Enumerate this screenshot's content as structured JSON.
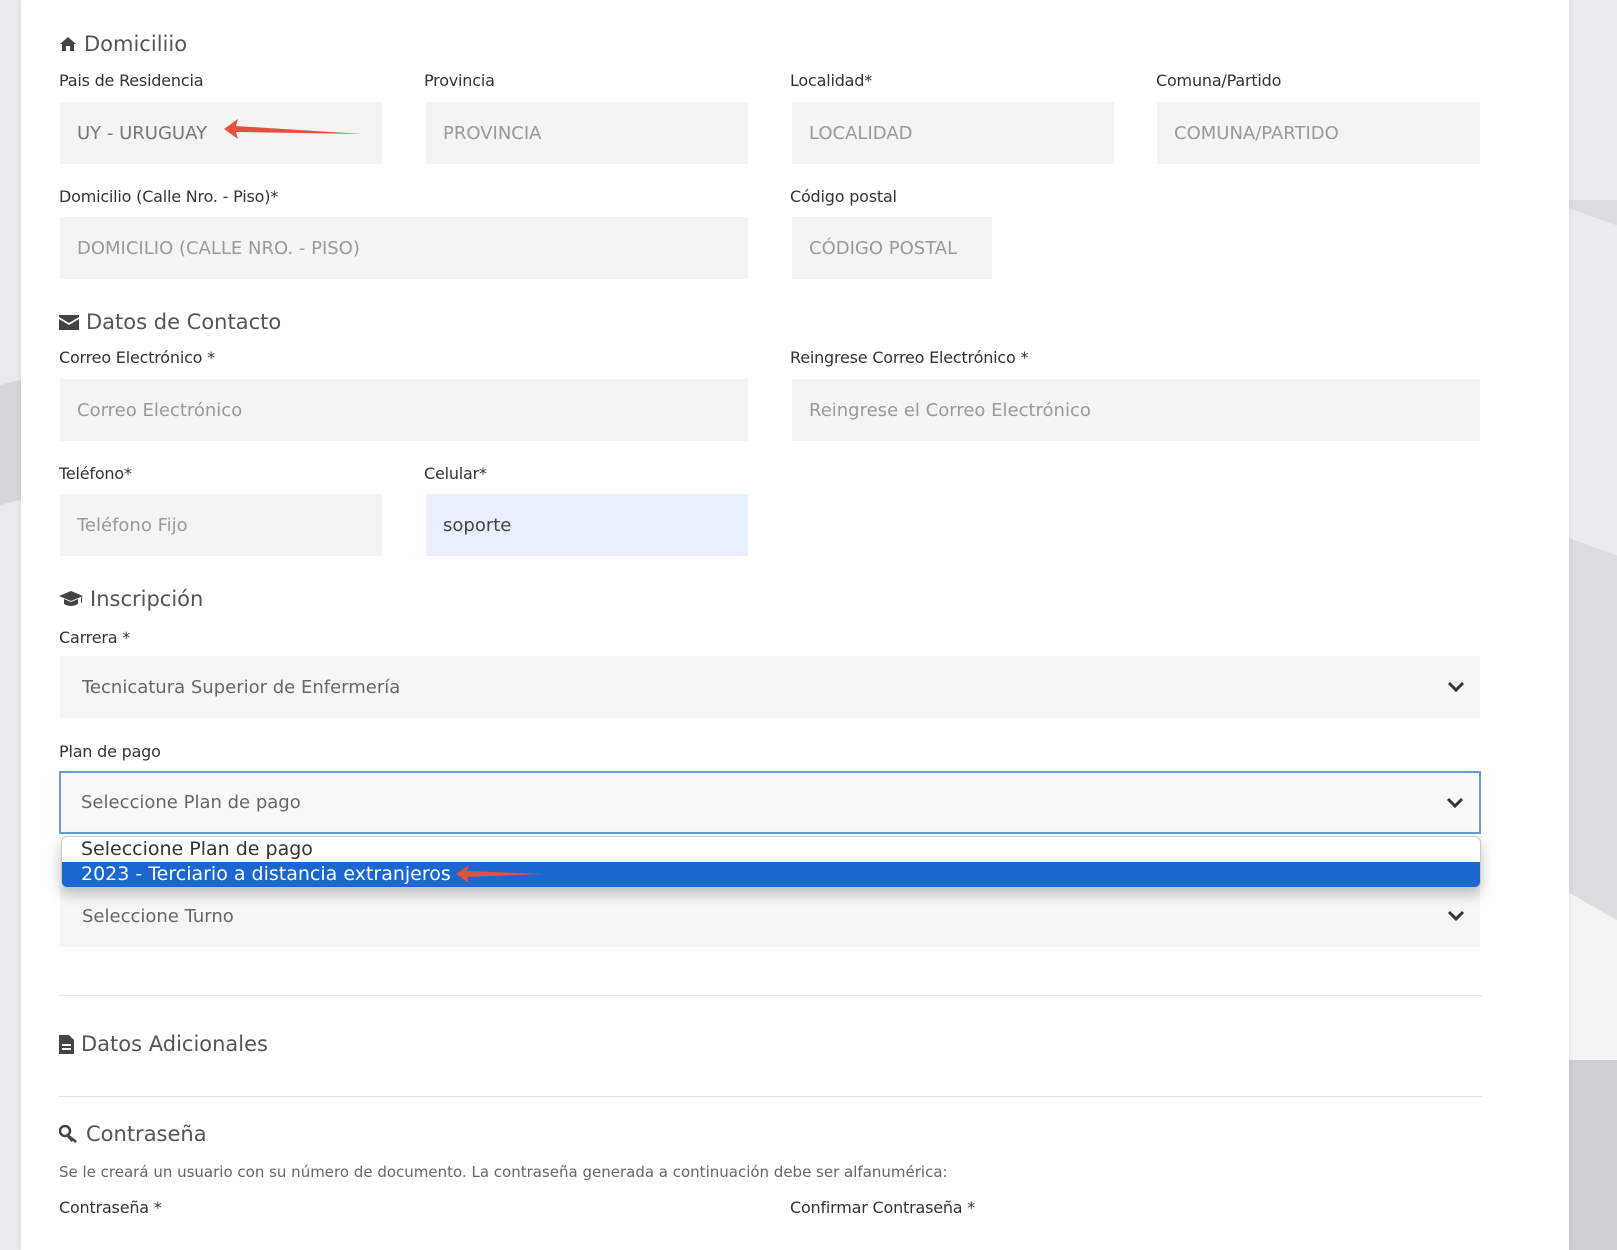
{
  "domicilio": {
    "title": "Domiciliio",
    "labels": {
      "pais": "Pais de Residencia",
      "provincia": "Provincia",
      "localidad": "Localidad*",
      "comuna": "Comuna/Partido",
      "domicilio": "Domicilio (Calle Nro. - Piso)*",
      "codigo_postal": "Código postal"
    },
    "values": {
      "pais": "UY - URUGUAY"
    },
    "placeholders": {
      "provincia": "PROVINCIA",
      "localidad": "LOCALIDAD",
      "comuna": "COMUNA/PARTIDO",
      "domicilio": "DOMICILIO (CALLE NRO. - PISO)",
      "codigo_postal": "CÓDIGO POSTAL"
    }
  },
  "contacto": {
    "title": "Datos de Contacto",
    "labels": {
      "correo": "Correo Electrónico *",
      "reingrese": "Reingrese Correo Electrónico *",
      "telefono": "Teléfono*",
      "celular": "Celular*"
    },
    "placeholders": {
      "correo": "Correo Electrónico",
      "reingrese": "Reingrese el Correo Electrónico",
      "telefono": "Teléfono Fijo"
    },
    "values": {
      "celular": "soporte"
    }
  },
  "inscripcion": {
    "title": "Inscripción",
    "labels": {
      "carrera": "Carrera *",
      "plan": "Plan de pago"
    },
    "carrera_selected": "Tecnicatura Superior de Enfermería",
    "plan_selected": "Seleccione Plan de pago",
    "plan_options": [
      "Seleccione Plan de pago",
      "2023 - Terciario a distancia extranjeros"
    ],
    "plan_highlighted_index": 1,
    "turno_selected": "Seleccione Turno"
  },
  "adicionales": {
    "title": "Datos Adicionales"
  },
  "contrasena": {
    "title": "Contraseña",
    "help": "Se le creará un usuario con su número de documento. La contraseña generada a continuación debe ser alfanumérica:",
    "labels": {
      "contrasena": "Contraseña *",
      "confirmar": "Confirmar Contraseña *"
    }
  },
  "annotation_color": "#e4503c",
  "accent_color": "#1a67d2"
}
